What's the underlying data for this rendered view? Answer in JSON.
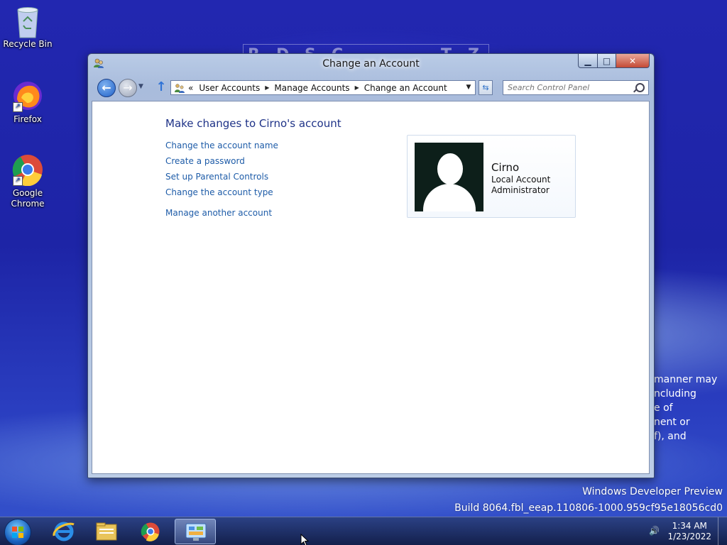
{
  "desktop": {
    "icons": [
      {
        "label": "Recycle Bin"
      },
      {
        "label": "Firefox"
      },
      {
        "label": "Google Chrome"
      }
    ],
    "background_text": {
      "top_letters": [
        "R",
        "D",
        "S",
        "C",
        "T",
        "Z"
      ],
      "side_lines": [
        "manner may",
        "ncluding",
        "e of",
        "nent or",
        "f), and"
      ]
    },
    "watermark": {
      "line1": "Windows Developer Preview",
      "line2": "Build 8064.fbl_eeap.110806-1000.959cf95e18056cd0"
    }
  },
  "window": {
    "title": "Change an Account",
    "controls": {
      "minimize": "▁",
      "maximize": "□",
      "close": "✕"
    },
    "address": {
      "overflow": "«",
      "crumbs": [
        "User Accounts",
        "Manage Accounts",
        "Change an Account"
      ]
    },
    "search": {
      "placeholder": "Search Control Panel"
    },
    "content": {
      "heading": "Make changes to Cirno's account",
      "tasks": [
        "Change the account name",
        "Create a password",
        "Set up Parental Controls",
        "Change the account type"
      ],
      "manage_other": "Manage another account",
      "account": {
        "name": "Cirno",
        "type": "Local Account",
        "role": "Administrator"
      }
    }
  },
  "taskbar": {
    "clock": {
      "time": "1:34 AM",
      "date": "1/23/2022"
    }
  },
  "colors": {
    "link": "#1e5ca8",
    "heading": "#1e3287",
    "desktop": "#2227b0"
  }
}
